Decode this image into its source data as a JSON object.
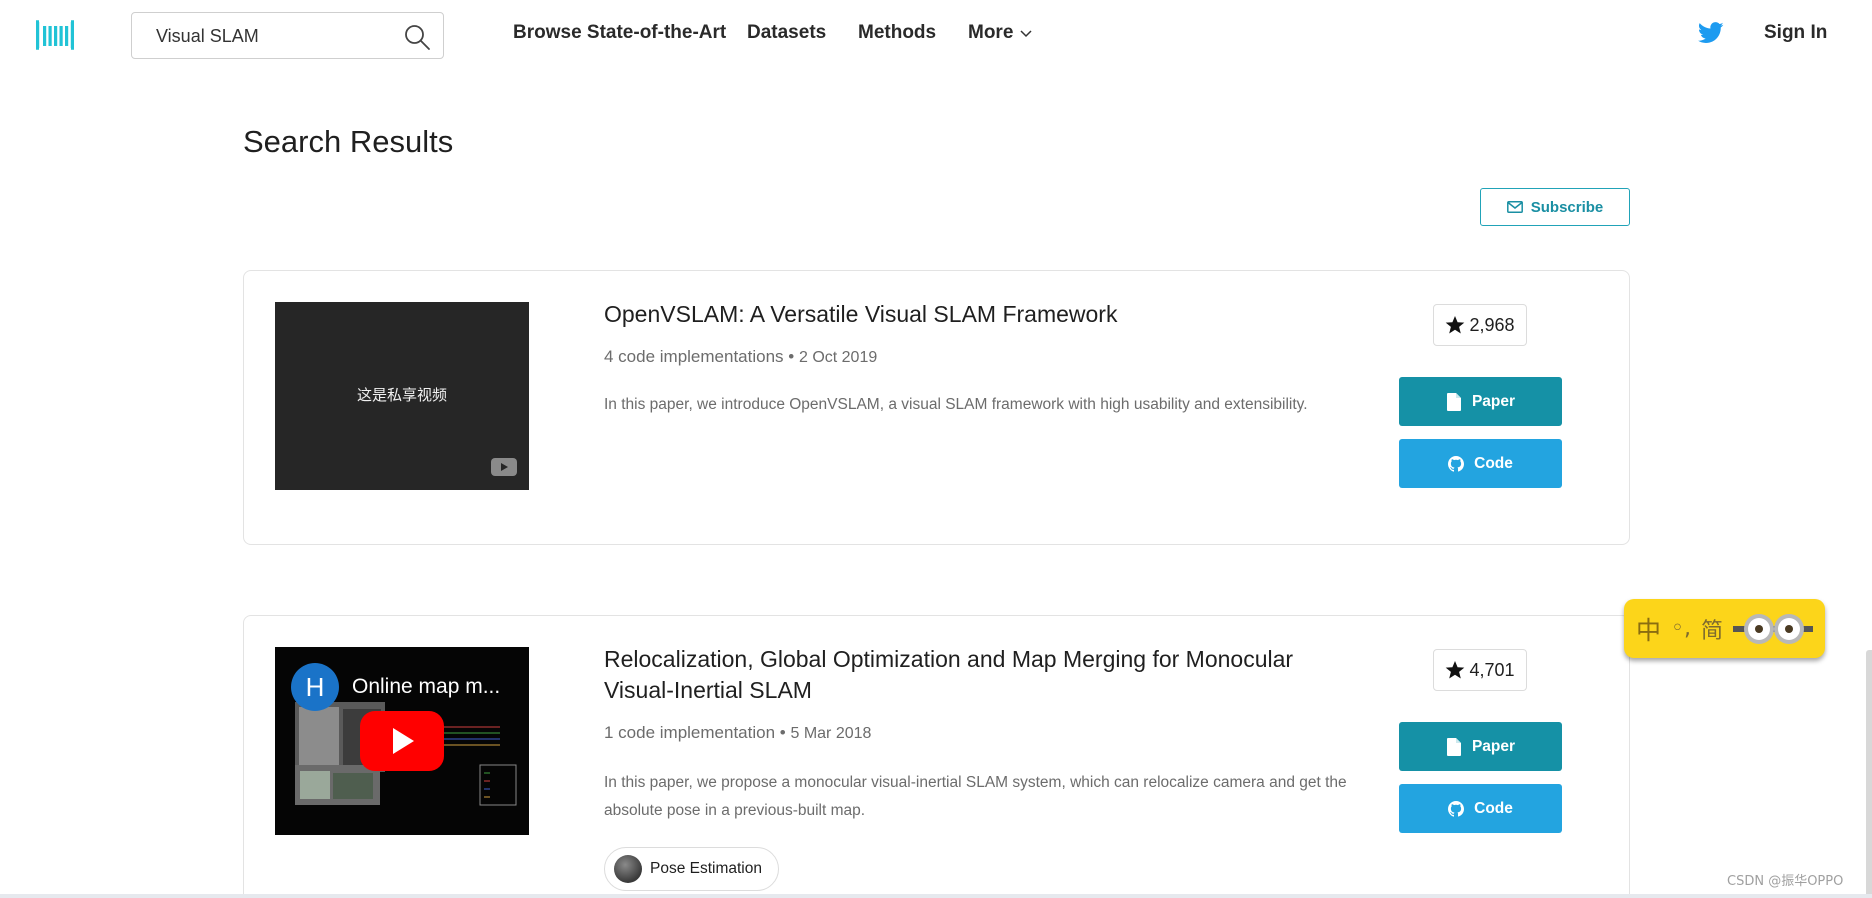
{
  "nav": {
    "search_value": "Visual SLAM",
    "links": [
      "Browse State-of-the-Art",
      "Datasets",
      "Methods",
      "More"
    ],
    "sign_in": "Sign In"
  },
  "page": {
    "title": "Search Results",
    "subscribe_label": "Subscribe"
  },
  "results": [
    {
      "thumbnail_text": "这是私享视频",
      "title": "OpenVSLAM: A Versatile Visual SLAM Framework",
      "implementations": "4 code implementations",
      "date": "2 Oct 2019",
      "abstract": "In this paper, we introduce OpenVSLAM, a visual SLAM framework with high usability and extensibility.",
      "stars": "2,968",
      "paper_label": "Paper",
      "code_label": "Code"
    },
    {
      "video_avatar": "H",
      "video_title": "Online map m...",
      "title": "Relocalization, Global Optimization and Map Merging for Monocular Visual-Inertial SLAM",
      "implementations": "1 code implementation",
      "date": "5 Mar 2018",
      "abstract": "In this paper, we propose a monocular visual-inertial SLAM system, which can relocalize camera and get the absolute pose in a previous-built map.",
      "task": "Pose Estimation",
      "stars": "4,701",
      "paper_label": "Paper",
      "code_label": "Code"
    }
  ],
  "ime": {
    "lang": "中",
    "punct": "◦,",
    "mode": "简"
  },
  "watermark": "CSDN @振华OPPO",
  "colors": {
    "accent_teal": "#1591a6",
    "code_blue": "#23a4e0",
    "logo_cyan": "#21c3d6",
    "ime_yellow": "#fcd51a"
  }
}
